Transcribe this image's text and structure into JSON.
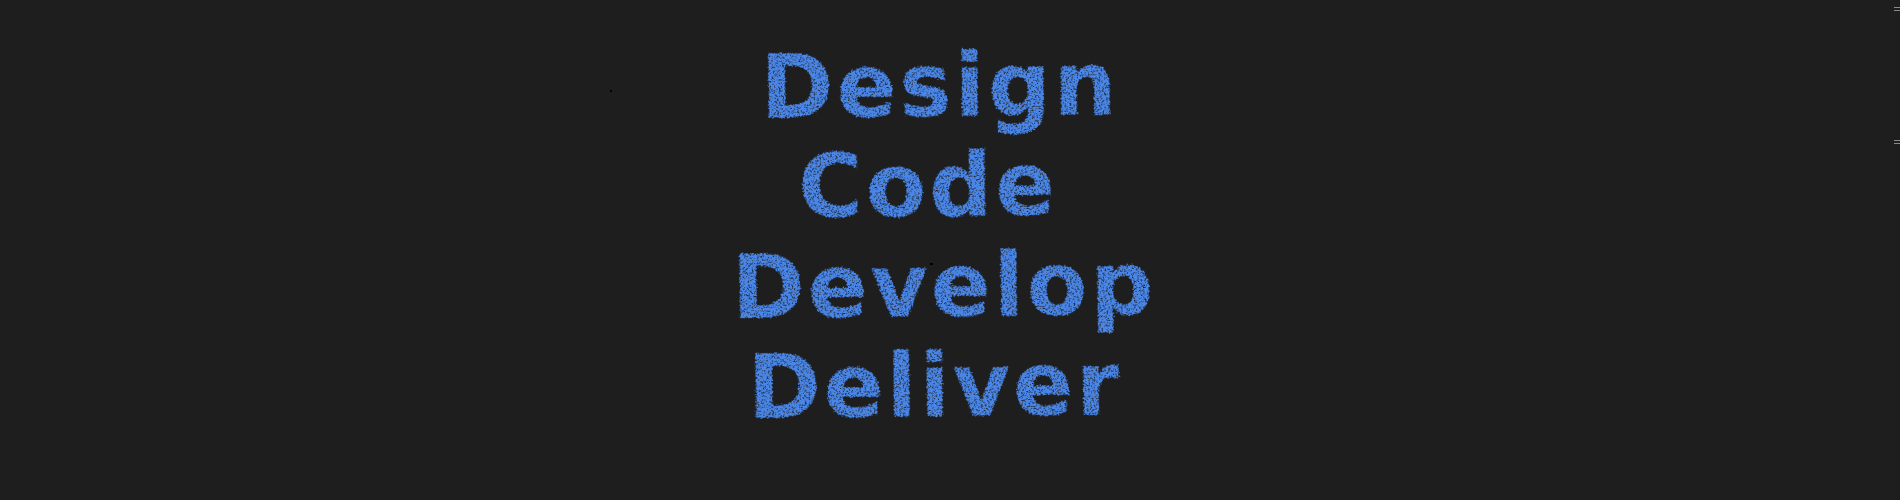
{
  "background_color": "#1e1e1f",
  "text_color": "#4a86e8",
  "words": [
    "Design",
    "Code",
    "Develop",
    "Deliver"
  ]
}
